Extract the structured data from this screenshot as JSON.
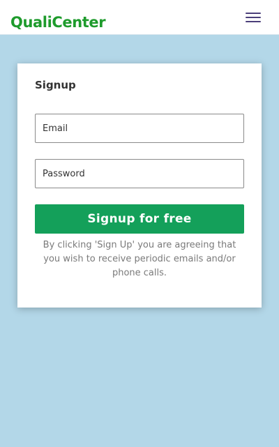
{
  "header": {
    "logo_text": "QualiCenter",
    "menu_icon": "hamburger-menu-icon"
  },
  "signup": {
    "title": "Signup",
    "email_placeholder": "Email",
    "password_placeholder": "Password",
    "submit_label": "Signup for free",
    "disclaimer": "By clicking 'Sign Up' you are agreeing that you wish to receive periodic emails and/or phone calls."
  },
  "colors": {
    "brand_green": "#1e9b2c",
    "button_green": "#14a05a",
    "background": "#b3d7e8",
    "menu_icon": "#4b3f7a"
  }
}
